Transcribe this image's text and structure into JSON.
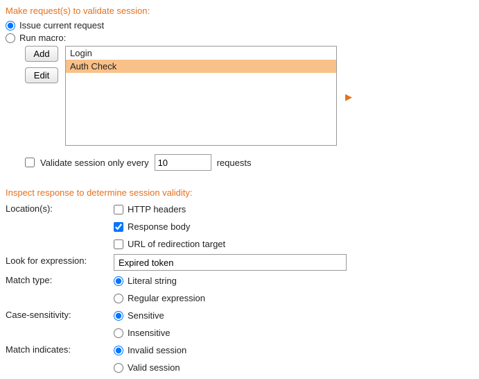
{
  "section1": {
    "heading": "Make request(s) to validate session:",
    "options": {
      "issue_current": "Issue current request",
      "run_macro": "Run macro:"
    },
    "selected_option": "issue_current",
    "buttons": {
      "add": "Add",
      "edit": "Edit"
    },
    "macros": [
      {
        "name": "Login",
        "selected": false
      },
      {
        "name": "Auth Check",
        "selected": true
      }
    ],
    "validate_every": {
      "label_prefix": "Validate session only every",
      "value": "10",
      "label_suffix": "requests",
      "checked": false
    }
  },
  "section2": {
    "heading": "Inspect response to determine session validity:",
    "locations": {
      "label": "Location(s):",
      "http_headers": {
        "label": "HTTP headers",
        "checked": false
      },
      "response_body": {
        "label": "Response body",
        "checked": true
      },
      "redirection_url": {
        "label": "URL of redirection target",
        "checked": false
      }
    },
    "expression": {
      "label": "Look for expression:",
      "value": "Expired token"
    },
    "match_type": {
      "label": "Match type:",
      "literal": "Literal string",
      "regex": "Regular expression",
      "selected": "literal"
    },
    "case": {
      "label": "Case-sensitivity:",
      "sensitive": "Sensitive",
      "insensitive": "Insensitive",
      "selected": "sensitive"
    },
    "indicates": {
      "label": "Match indicates:",
      "invalid": "Invalid session",
      "valid": "Valid session",
      "selected": "invalid"
    }
  }
}
